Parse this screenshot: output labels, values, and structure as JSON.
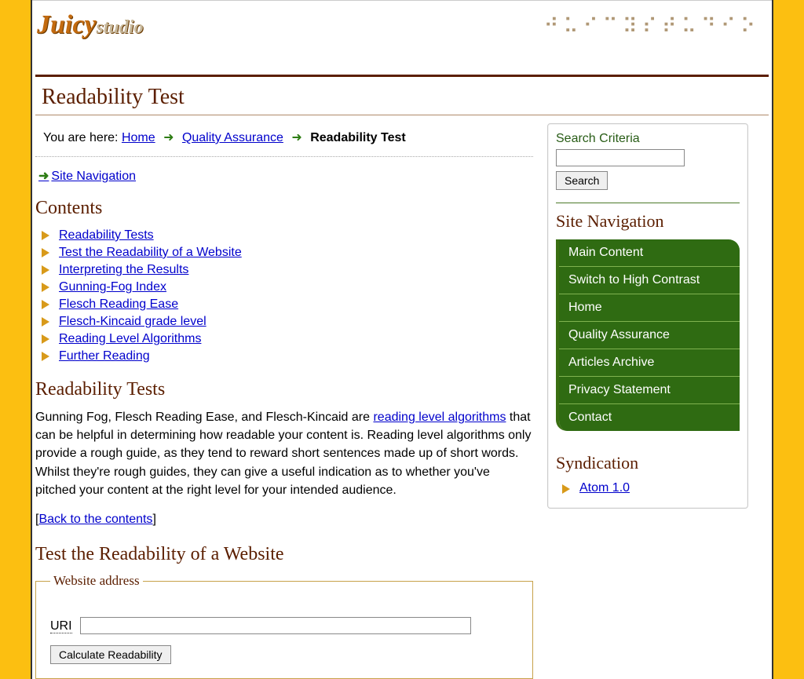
{
  "header": {
    "logo_main": "Juicy",
    "logo_sub": "studio"
  },
  "page_title": "Readability Test",
  "breadcrumb": {
    "prefix": "You are here: ",
    "items": [
      "Home",
      "Quality Assurance"
    ],
    "current": "Readability Test"
  },
  "skip_link": "Site Navigation",
  "contents": {
    "heading": "Contents",
    "links": [
      "Readability Tests",
      "Test the Readability of a Website",
      "Interpreting the Results",
      "Gunning-Fog Index",
      "Flesch Reading Ease",
      "Flesch-Kincaid grade level",
      "Reading Level Algorithms",
      "Further Reading"
    ]
  },
  "section_readability": {
    "heading": "Readability Tests",
    "para_pre": "Gunning Fog, Flesch Reading Ease, and Flesch-Kincaid are ",
    "para_link": "reading level algorithms",
    "para_post": " that can be helpful in determining how readable your content is. Reading level algorithms only provide a rough guide, as they tend to reward short sentences made up of short words. Whilst they're rough guides, they can give a useful indication as to whether you've pitched your content at the right level for your intended audience.",
    "back_link": "Back to the contents"
  },
  "section_test": {
    "heading": "Test the Readability of a Website",
    "legend": "Website address",
    "uri_label": "URI",
    "submit_label": "Calculate Readability"
  },
  "search": {
    "label": "Search Criteria",
    "button": "Search"
  },
  "site_nav": {
    "heading": "Site Navigation",
    "items": [
      "Main Content",
      "Switch to High Contrast",
      "Home",
      "Quality Assurance",
      "Articles Archive",
      "Privacy Statement",
      "Contact"
    ]
  },
  "syndication": {
    "heading": "Syndication",
    "link": "Atom 1.0"
  }
}
